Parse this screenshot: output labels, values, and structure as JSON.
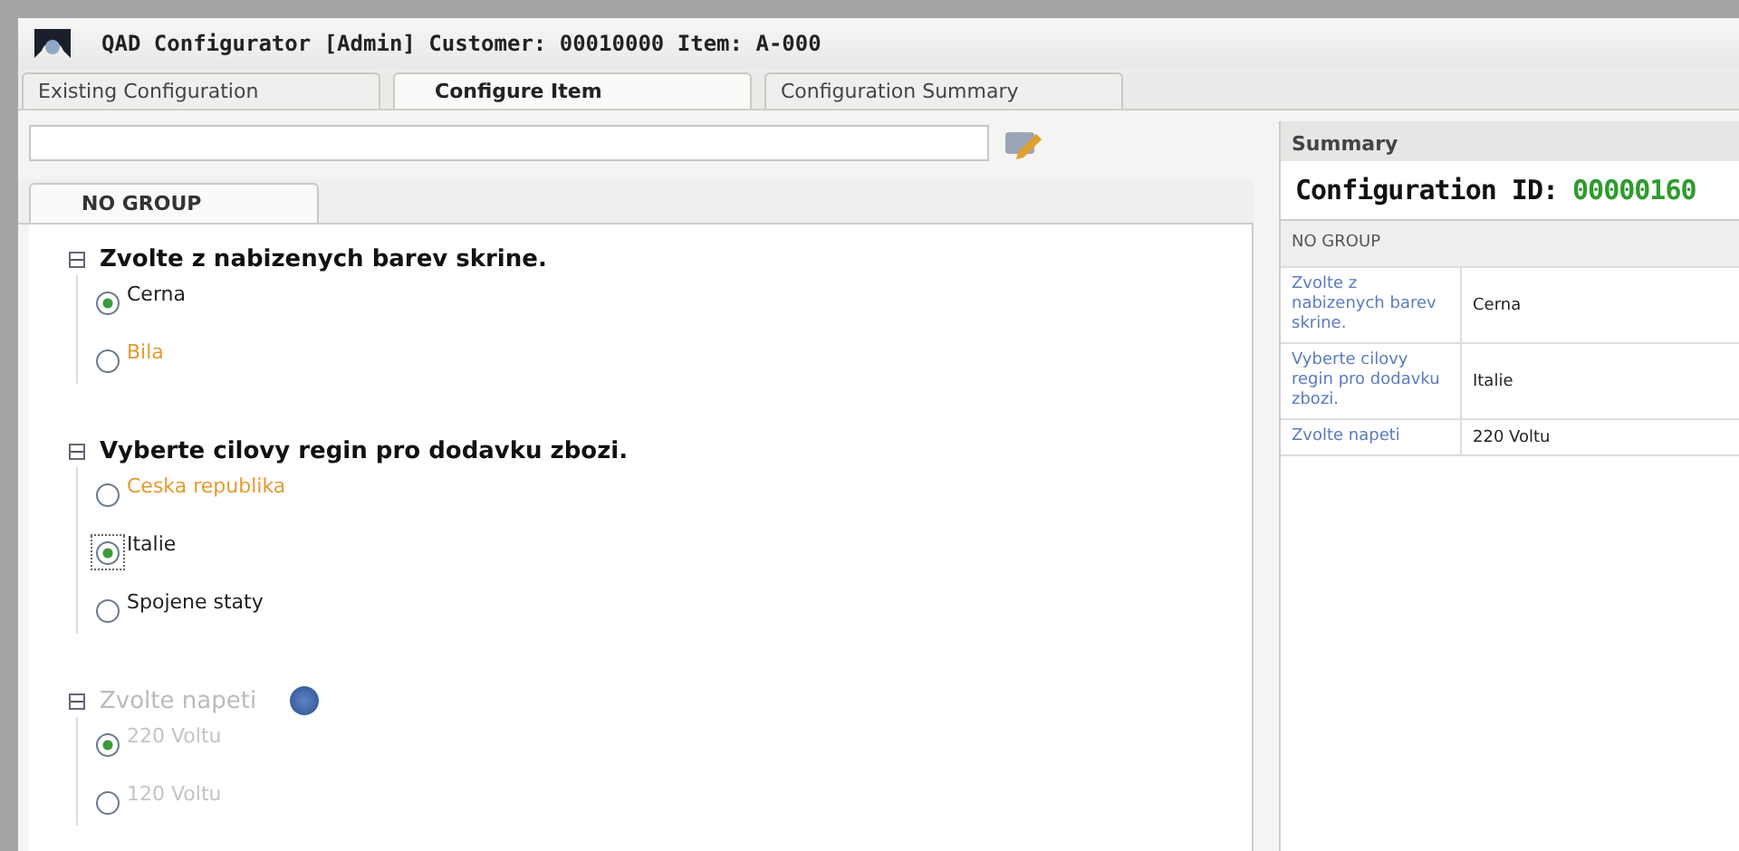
{
  "window": {
    "title": "QAD Configurator [Admin] Customer: 00010000 Item: A-000"
  },
  "tabs": [
    {
      "label": "Existing Configuration",
      "selected": false
    },
    {
      "label": "Configure Item",
      "selected": true
    },
    {
      "label": "Configuration Summary",
      "selected": false
    }
  ],
  "group_tab": {
    "label": "NO GROUP"
  },
  "questions": [
    {
      "text": "Zvolte z nabizenych barev skrine.",
      "disabled": false,
      "help": false,
      "options": [
        {
          "label": "Cerna",
          "selected": true,
          "highlighted": false,
          "focused": false
        },
        {
          "label": "Bila",
          "selected": false,
          "highlighted": true,
          "focused": false
        }
      ]
    },
    {
      "text": "Vyberte cilovy regin pro dodavku zbozi.",
      "disabled": false,
      "help": false,
      "options": [
        {
          "label": "Ceska republika",
          "selected": false,
          "highlighted": true,
          "focused": false
        },
        {
          "label": "Italie",
          "selected": true,
          "highlighted": false,
          "focused": true
        },
        {
          "label": "Spojene staty",
          "selected": false,
          "highlighted": false,
          "focused": false
        }
      ]
    },
    {
      "text": "Zvolte napeti",
      "disabled": true,
      "help": true,
      "options": [
        {
          "label": "220 Voltu",
          "selected": true,
          "highlighted": false,
          "focused": false
        },
        {
          "label": "120 Voltu",
          "selected": false,
          "highlighted": false,
          "focused": false
        }
      ]
    }
  ],
  "summary": {
    "title": "Summary",
    "config_label": "Configuration ID:",
    "config_id": "00000160",
    "group": "NO GROUP",
    "rows": [
      {
        "question": "Zvolte z nabizenych barev skrine.",
        "answer": "Cerna"
      },
      {
        "question": "Vyberte cilovy regin pro dodavku zbozi.",
        "answer": "Italie"
      },
      {
        "question": "Zvolte napeti",
        "answer": "220 Voltu"
      }
    ]
  }
}
